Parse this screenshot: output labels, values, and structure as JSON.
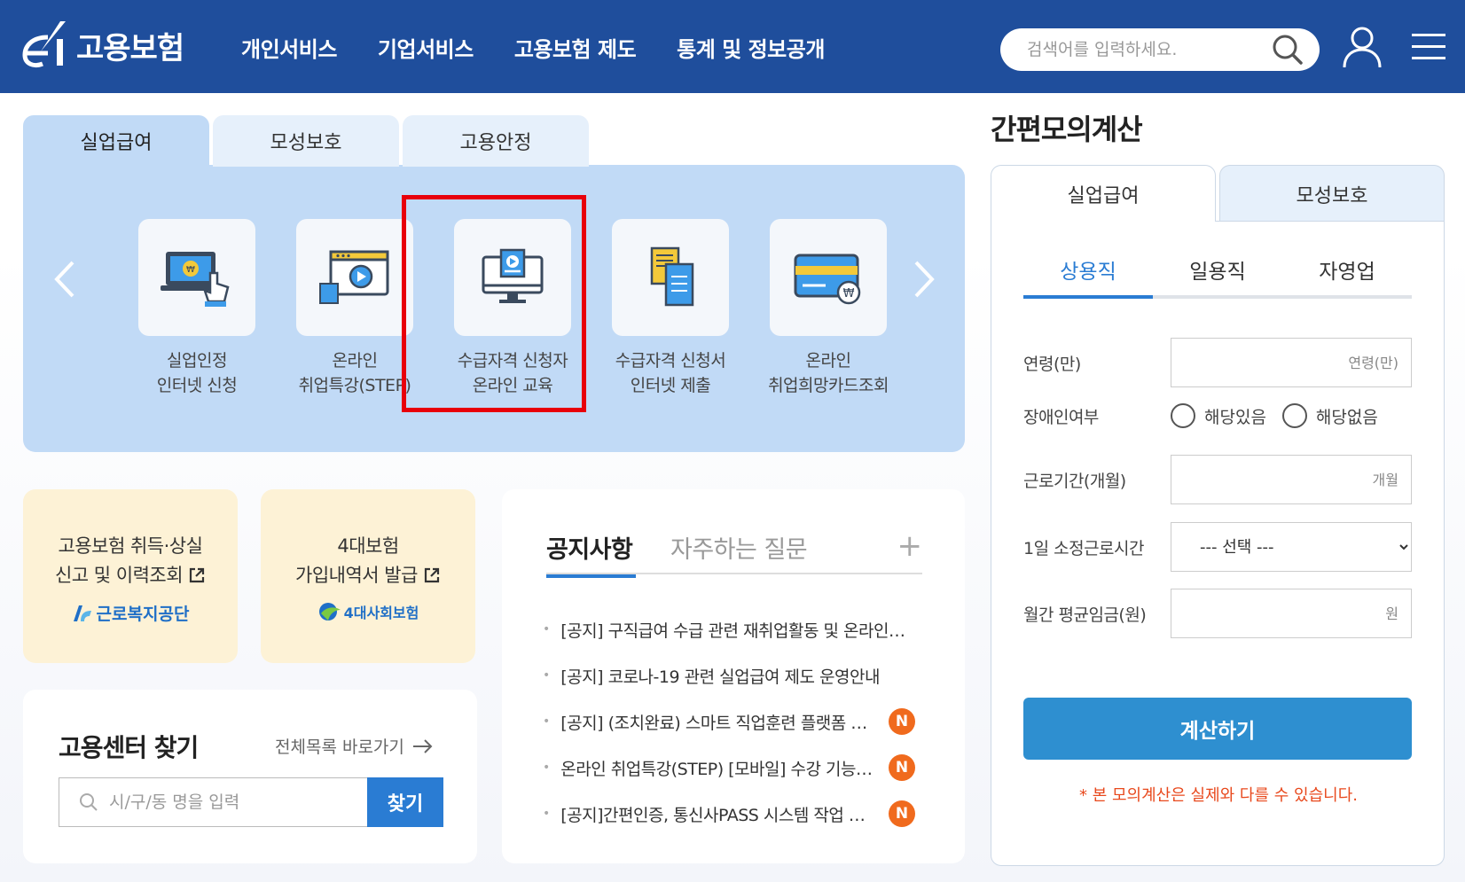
{
  "header": {
    "logo_text": "고용보험",
    "nav": [
      "개인서비스",
      "기업서비스",
      "고용보험 제도",
      "통계 및 정보공개"
    ],
    "search_placeholder": "검색어를 입력하세요.",
    "bg_color": "#1f4e9c"
  },
  "services": {
    "tabs": [
      "실업급여",
      "모성보호",
      "고용안정"
    ],
    "active_tab": 0,
    "items": [
      {
        "line1": "실업인정",
        "line2": "인터넷 신청",
        "icon": "laptop-touch-icon"
      },
      {
        "line1": "온라인",
        "line2": "취업특강(STEP)",
        "icon": "video-browser-icon"
      },
      {
        "line1": "수급자격 신청자",
        "line2": "온라인 교육",
        "icon": "monitor-play-icon"
      },
      {
        "line1": "수급자격 신청서",
        "line2": "인터넷 제출",
        "icon": "documents-icon"
      },
      {
        "line1": "온라인",
        "line2": "취업희망카드조회",
        "icon": "card-icon"
      }
    ],
    "highlighted_item": 2
  },
  "quick_cards": [
    {
      "line1": "고용보험 취득·상실",
      "line2": "신고 및 이력조회",
      "org": "근로복지공단"
    },
    {
      "line1": "4대보험",
      "line2": "가입내역서 발급",
      "org": "4대사회보험"
    }
  ],
  "center_finder": {
    "title": "고용센터 찾기",
    "link": "전체목록 바로가기",
    "placeholder": "시/구/동 명을 입력",
    "button": "찾기"
  },
  "notice": {
    "tab_active": "공지사항",
    "tab_inactive": "자주하는 질문",
    "plus": "+",
    "badge": "N",
    "items": [
      {
        "text": "[공지] 구직급여 수급 관련 재취업활동 및 온라인 취업특강 안내",
        "new": false
      },
      {
        "text": "[공지] 코로나-19 관련 실업급여 제도 운영안내",
        "new": false
      },
      {
        "text": "[공지] (조치완료) 스마트 직업훈련 플랫폼 접속 장애 안내",
        "new": true
      },
      {
        "text": "온라인 취업특강(STEP) [모바일] 수강 기능 안내",
        "new": true
      },
      {
        "text": "[공지]간편인증, 통신사PASS 시스템 작업 안내",
        "new": true
      }
    ]
  },
  "calculator": {
    "title": "간편모의계산",
    "tabs": [
      "실업급여",
      "모성보호"
    ],
    "sub_tabs": [
      "상용직",
      "일용직",
      "자영업"
    ],
    "labels": {
      "age": "연령(만)",
      "disability": "장애인여부",
      "period": "근로기간(개월)",
      "hours": "1일 소정근로시간",
      "wage": "월간 평균임금(원)"
    },
    "placeholders": {
      "age": "연령(만)",
      "period": "개월",
      "wage": "원"
    },
    "radio": [
      "해당있음",
      "해당없음"
    ],
    "select_default": "--- 선택 ---",
    "button": "계산하기",
    "note": "* 본 모의계산은 실제와 다를 수 있습니다."
  }
}
